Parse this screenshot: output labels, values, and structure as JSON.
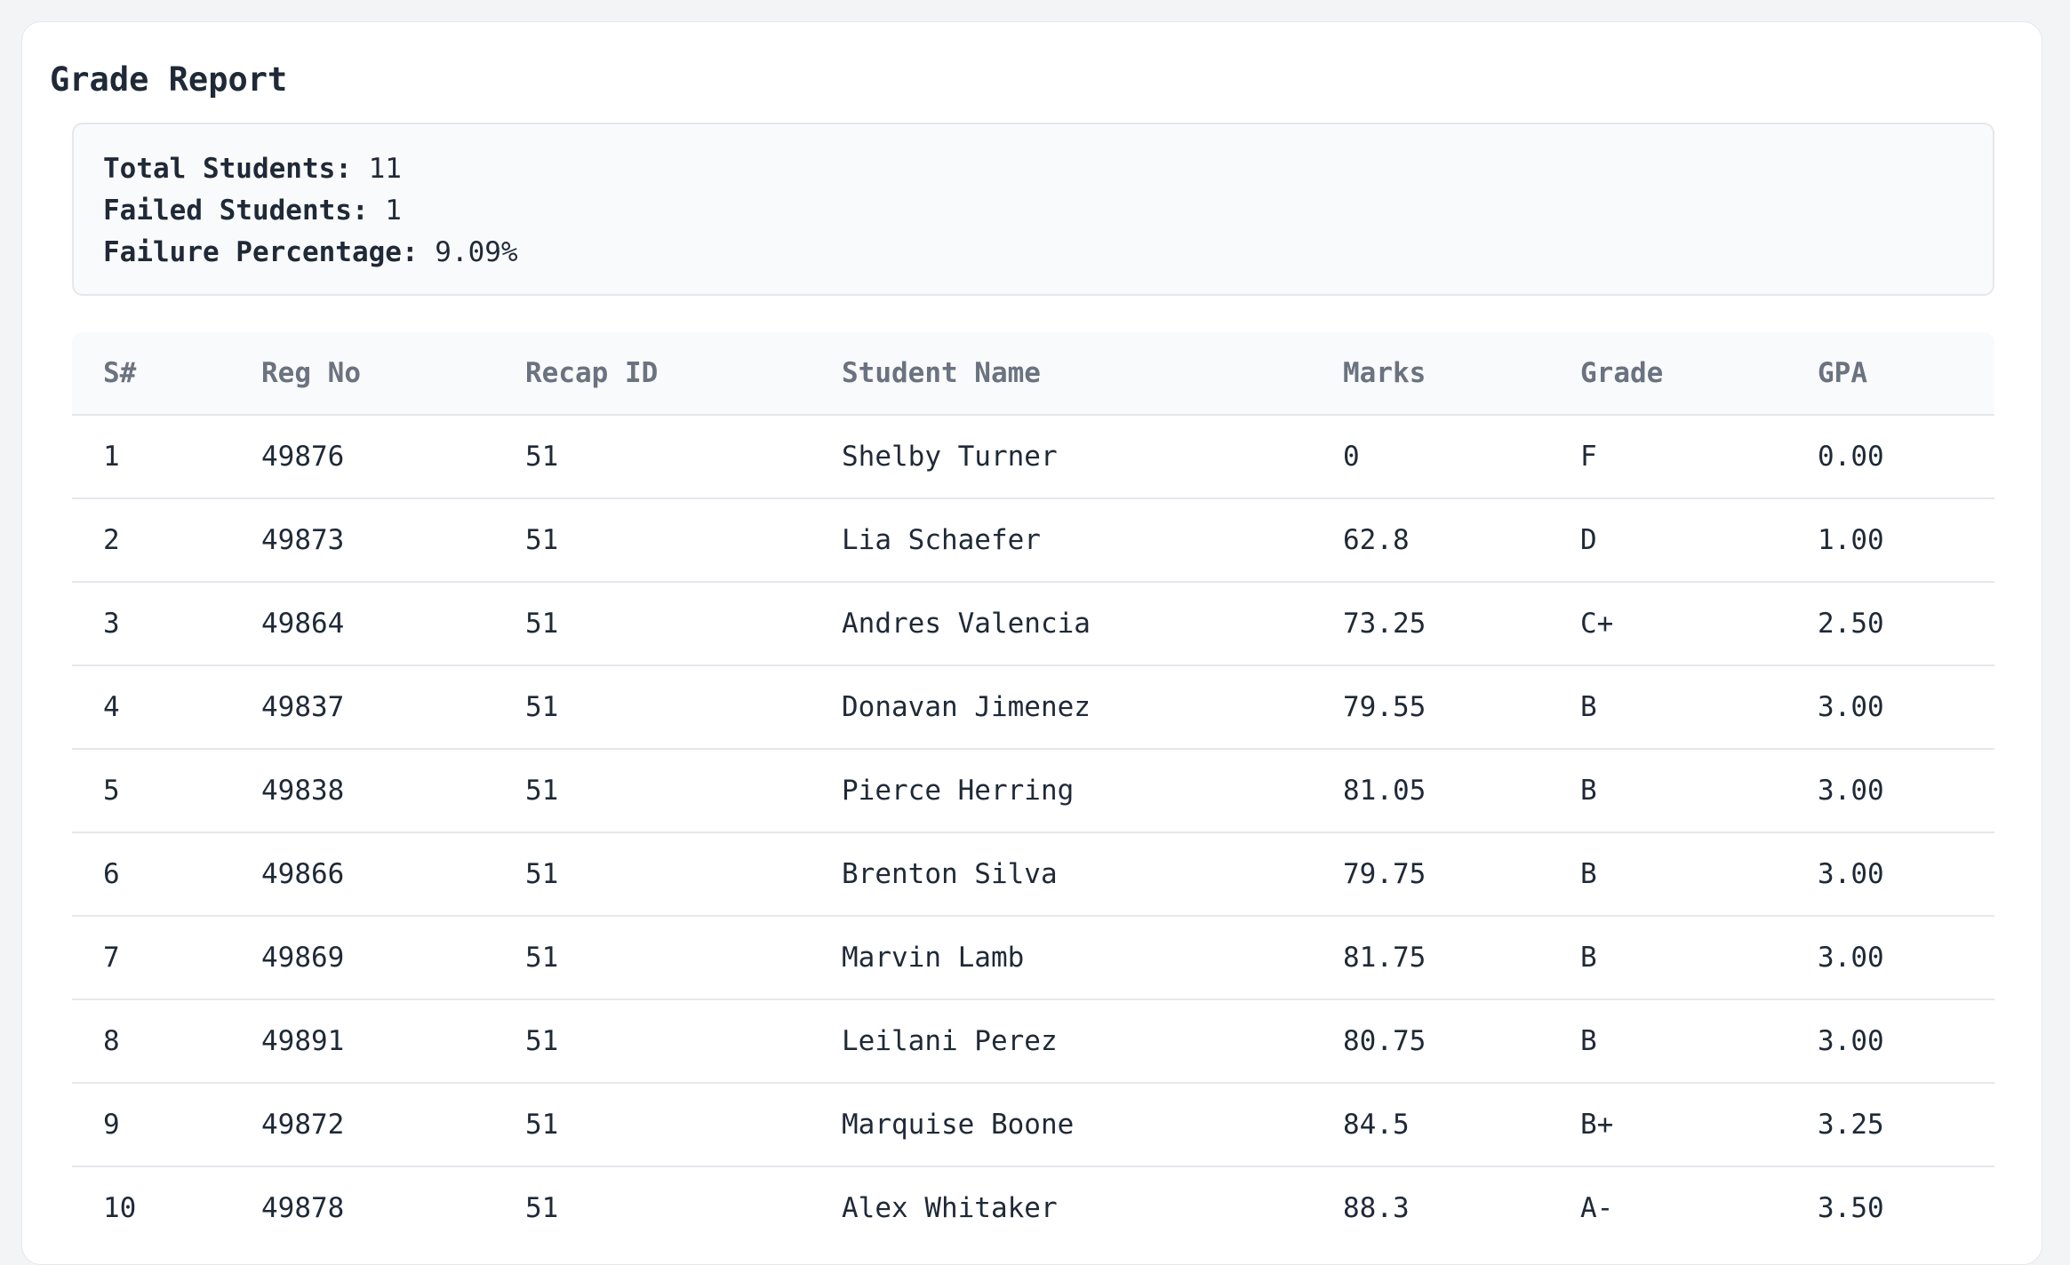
{
  "page": {
    "title": "Grade Report"
  },
  "summary": {
    "total_students_label": "Total Students:",
    "total_students_value": "11",
    "failed_students_label": "Failed Students:",
    "failed_students_value": "1",
    "failure_percentage_label": "Failure Percentage:",
    "failure_percentage_value": "9.09%"
  },
  "table": {
    "columns": [
      "S#",
      "Reg No",
      "Recap ID",
      "Student Name",
      "Marks",
      "Grade",
      "GPA"
    ],
    "rows": [
      [
        "1",
        "49876",
        "51",
        "Shelby Turner",
        "0",
        "F",
        "0.00"
      ],
      [
        "2",
        "49873",
        "51",
        "Lia Schaefer",
        "62.8",
        "D",
        "1.00"
      ],
      [
        "3",
        "49864",
        "51",
        "Andres Valencia",
        "73.25",
        "C+",
        "2.50"
      ],
      [
        "4",
        "49837",
        "51",
        "Donavan Jimenez",
        "79.55",
        "B",
        "3.00"
      ],
      [
        "5",
        "49838",
        "51",
        "Pierce Herring",
        "81.05",
        "B",
        "3.00"
      ],
      [
        "6",
        "49866",
        "51",
        "Brenton Silva",
        "79.75",
        "B",
        "3.00"
      ],
      [
        "7",
        "49869",
        "51",
        "Marvin Lamb",
        "81.75",
        "B",
        "3.00"
      ],
      [
        "8",
        "49891",
        "51",
        "Leilani Perez",
        "80.75",
        "B",
        "3.00"
      ],
      [
        "9",
        "49872",
        "51",
        "Marquise Boone",
        "84.5",
        "B+",
        "3.25"
      ],
      [
        "10",
        "49878",
        "51",
        "Alex Whitaker",
        "88.3",
        "A-",
        "3.50"
      ]
    ]
  }
}
